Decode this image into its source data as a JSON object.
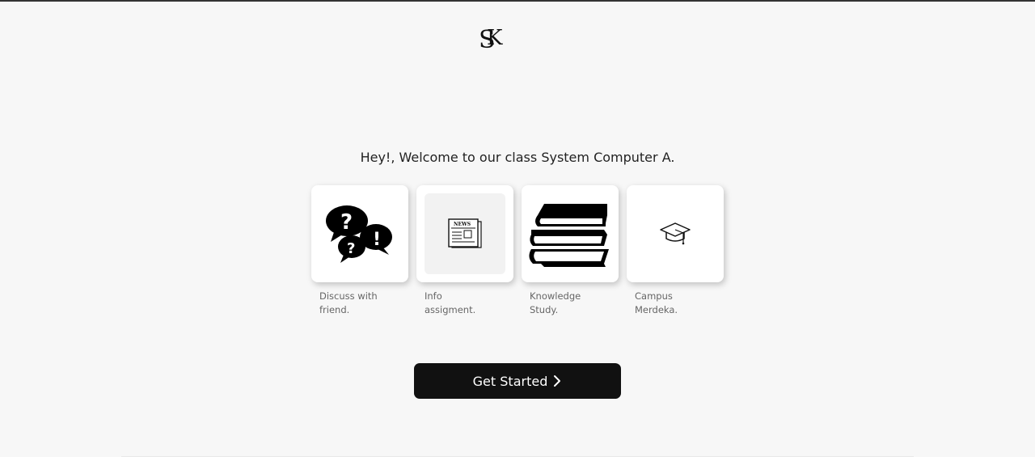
{
  "brand": {
    "logo_icon": "sk-monogram-logo"
  },
  "welcome": {
    "text": "Hey!, Welcome to our class System Computer A."
  },
  "cards": [
    {
      "icon": "speech-bubbles-question-icon",
      "label": "Discuss with friend."
    },
    {
      "icon": "newspaper-icon",
      "label": "Info assigment.",
      "icon_text": "NEWS"
    },
    {
      "icon": "stack-of-books-icon",
      "label": "Knowledge Study."
    },
    {
      "icon": "graduation-cap-icon",
      "label": "Campus Merdeka."
    }
  ],
  "cta": {
    "label": "Get Started",
    "icon": "chevron-right-icon"
  },
  "colors": {
    "background": "#f7f7f7",
    "button": "#111111",
    "card": "#ffffff"
  }
}
